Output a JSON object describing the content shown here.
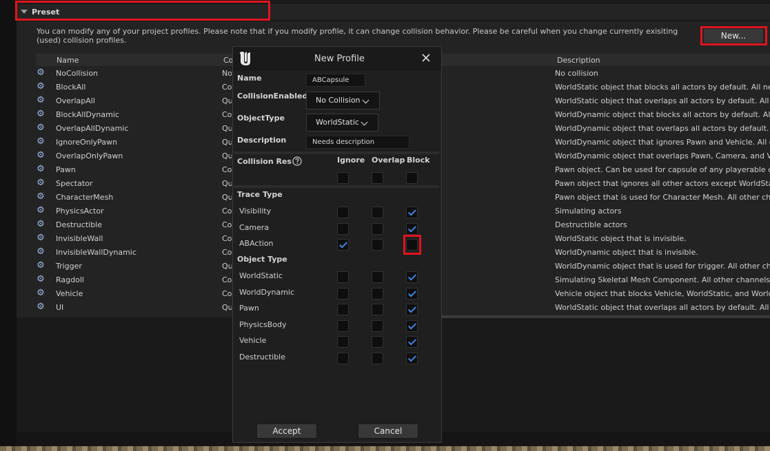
{
  "preset": {
    "title": "Preset",
    "info": "You can modify any of your project profiles. Please note that if you modify profile, it can change collision behavior. Please be careful when you change currently exisiting (used) collision profiles.",
    "new_button": "New..."
  },
  "table": {
    "headers": [
      "Name",
      "Co",
      "Description"
    ],
    "rows": [
      {
        "name": "NoCollision",
        "coll": "No",
        "desc": "No collision"
      },
      {
        "name": "BlockAll",
        "coll": "Co",
        "desc": "WorldStatic object that blocks all actors by default. All new cu"
      },
      {
        "name": "OverlapAll",
        "coll": "Qu",
        "desc": "WorldStatic object that overlaps all actors by default. All new c"
      },
      {
        "name": "BlockAllDynamic",
        "coll": "Co",
        "desc": "WorldDynamic object that blocks all actors by default. All new"
      },
      {
        "name": "OverlapAllDynamic",
        "coll": "Qu",
        "desc": "WorldDynamic object that overlaps all actors by default. All ne"
      },
      {
        "name": "IgnoreOnlyPawn",
        "coll": "Qu",
        "desc": "WorldDynamic object that ignores Pawn and Vehicle. All other"
      },
      {
        "name": "OverlapOnlyPawn",
        "coll": "Qu",
        "desc": "WorldDynamic object that overlaps Pawn, Camera, and Vehicle"
      },
      {
        "name": "Pawn",
        "coll": "Co",
        "desc": "Pawn object. Can be used for capsule of any playerable charac"
      },
      {
        "name": "Spectator",
        "coll": "Qu",
        "desc": "Pawn object that ignores all other actors except WorldStatic."
      },
      {
        "name": "CharacterMesh",
        "coll": "Qu",
        "desc": "Pawn object that is used for Character Mesh. All other channel"
      },
      {
        "name": "PhysicsActor",
        "coll": "Co",
        "desc": "Simulating actors"
      },
      {
        "name": "Destructible",
        "coll": "Co",
        "desc": "Destructible actors"
      },
      {
        "name": "InvisibleWall",
        "coll": "Co",
        "desc": "WorldStatic object that is invisible."
      },
      {
        "name": "InvisibleWallDynamic",
        "coll": "Co",
        "desc": "WorldDynamic object that is invisible."
      },
      {
        "name": "Trigger",
        "coll": "Qu",
        "desc": "WorldDynamic object that is used for trigger. All other channel"
      },
      {
        "name": "Ragdoll",
        "coll": "Co",
        "desc": "Simulating Skeletal Mesh Component. All other channels will b"
      },
      {
        "name": "Vehicle",
        "coll": "Co",
        "desc": "Vehicle object that blocks Vehicle, WorldStatic, and WorldDyna"
      },
      {
        "name": "UI",
        "coll": "Qu",
        "desc": "WorldStatic object that overlaps all actors by default. All new c"
      }
    ]
  },
  "modal": {
    "title": "New Profile",
    "name_label": "Name",
    "name_value": "ABCapsule",
    "collision_enabled_label": "CollisionEnabled",
    "collision_enabled_value": "No Collision",
    "object_type_label": "ObjectType",
    "object_type_value": "WorldStatic",
    "description_label": "Description",
    "description_value": "Needs description",
    "collision_response_label": "Collision Response",
    "col_ignore": "Ignore",
    "col_overlap": "Overlap",
    "col_block": "Block",
    "trace_type_label": "Trace Type",
    "object_type_section_label": "Object Type",
    "trace_channels": [
      {
        "label": "Visibility",
        "ignore": false,
        "overlap": false,
        "block": true
      },
      {
        "label": "Camera",
        "ignore": false,
        "overlap": false,
        "block": true
      },
      {
        "label": "ABAction",
        "ignore": true,
        "overlap": false,
        "block": false
      }
    ],
    "object_channels": [
      {
        "label": "WorldStatic",
        "ignore": false,
        "overlap": false,
        "block": true
      },
      {
        "label": "WorldDynamic",
        "ignore": false,
        "overlap": false,
        "block": true
      },
      {
        "label": "Pawn",
        "ignore": false,
        "overlap": false,
        "block": true
      },
      {
        "label": "PhysicsBody",
        "ignore": false,
        "overlap": false,
        "block": true
      },
      {
        "label": "Vehicle",
        "ignore": false,
        "overlap": false,
        "block": true
      },
      {
        "label": "Destructible",
        "ignore": false,
        "overlap": false,
        "block": true
      }
    ],
    "accept_label": "Accept",
    "cancel_label": "Cancel"
  }
}
